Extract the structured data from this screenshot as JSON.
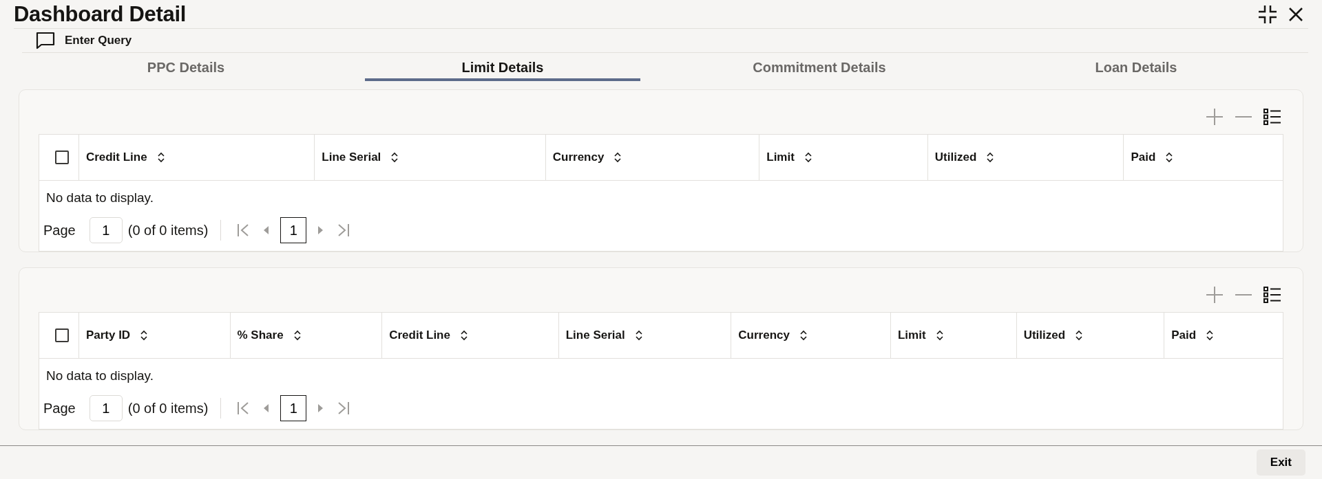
{
  "window": {
    "title": "Dashboard Detail"
  },
  "toolbar": {
    "label": "Enter Query"
  },
  "tabs": [
    {
      "label": "PPC Details",
      "selected": false
    },
    {
      "label": "Limit Details",
      "selected": true
    },
    {
      "label": "Commitment Details",
      "selected": false
    },
    {
      "label": "Loan Details",
      "selected": false
    }
  ],
  "tables": [
    {
      "select_all_checked": false,
      "columns": [
        "Credit Line",
        "Line Serial",
        "Currency",
        "Limit",
        "Utilized",
        "Paid"
      ],
      "empty_text": "No data to display.",
      "pager": {
        "page_label": "Page",
        "page_value": "1",
        "summary": "(0 of 0 items)",
        "current_page": "1"
      }
    },
    {
      "select_all_checked": false,
      "columns": [
        "Party ID",
        "% Share",
        "Credit Line",
        "Line Serial",
        "Currency",
        "Limit",
        "Utilized",
        "Paid"
      ],
      "empty_text": "No data to display.",
      "pager": {
        "page_label": "Page",
        "page_value": "1",
        "summary": "(0 of 0 items)",
        "current_page": "1"
      }
    }
  ],
  "footer": {
    "button": "Exit"
  }
}
